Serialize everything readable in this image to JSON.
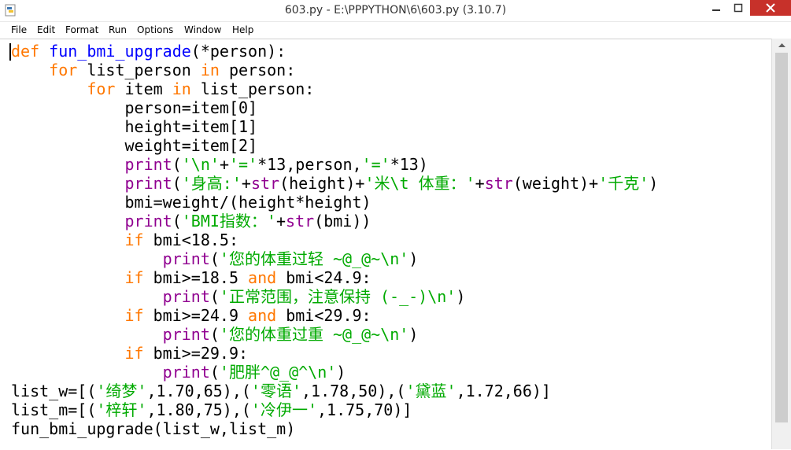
{
  "window": {
    "title": "603.py - E:\\PPPYTHON\\6\\603.py (3.10.7)"
  },
  "menu": [
    "File",
    "Edit",
    "Format",
    "Run",
    "Options",
    "Window",
    "Help"
  ],
  "code": {
    "l1": {
      "a": "def",
      "b": " ",
      "c": "fun_bmi_upgrade",
      "d": "(*person):"
    },
    "l2": {
      "a": "    ",
      "b": "for",
      "c": " list_person ",
      "d": "in",
      "e": " person:"
    },
    "l3": {
      "a": "        ",
      "b": "for",
      "c": " item ",
      "d": "in",
      "e": " list_person:"
    },
    "l4": "            person=item[0]",
    "l5": "            height=item[1]",
    "l6": "            weight=item[2]",
    "l7": {
      "a": "            ",
      "b": "print",
      "c": "(",
      "d": "'\\n'",
      "e": "+",
      "f": "'='",
      "g": "*13,person,",
      "h": "'='",
      "i": "*13)"
    },
    "l8": {
      "a": "            ",
      "b": "print",
      "c": "(",
      "d": "'身高:'",
      "e": "+",
      "f": "str",
      "g": "(height)+",
      "h": "'米\\t 体重：'",
      "i": "+",
      "j": "str",
      "k": "(weight)+",
      "l": "'千克'",
      "m": ")"
    },
    "l9": "            bmi=weight/(height*height)",
    "l10": {
      "a": "            ",
      "b": "print",
      "c": "(",
      "d": "'BMI指数：'",
      "e": "+",
      "f": "str",
      "g": "(bmi))"
    },
    "l11": {
      "a": "            ",
      "b": "if",
      "c": " bmi<18.5:"
    },
    "l12": {
      "a": "                ",
      "b": "print",
      "c": "(",
      "d": "'您的体重过轻 ~@_@~\\n'",
      "e": ")"
    },
    "l13": {
      "a": "            ",
      "b": "if",
      "c": " bmi>=18.5 ",
      "d": "and",
      "e": " bmi<24.9:"
    },
    "l14": {
      "a": "                ",
      "b": "print",
      "c": "(",
      "d": "'正常范围，注意保持 (-_-)\\n'",
      "e": ")"
    },
    "l15": {
      "a": "            ",
      "b": "if",
      "c": " bmi>=24.9 ",
      "d": "and",
      "e": " bmi<29.9:"
    },
    "l16": {
      "a": "                ",
      "b": "print",
      "c": "(",
      "d": "'您的体重过重 ~@_@~\\n'",
      "e": ")"
    },
    "l17": {
      "a": "            ",
      "b": "if",
      "c": " bmi>=29.9:"
    },
    "l18": {
      "a": "                ",
      "b": "print",
      "c": "(",
      "d": "'肥胖^@_@^\\n'",
      "e": ")"
    },
    "l19": {
      "a": "list_w=[(",
      "b": "'绮梦'",
      "c": ",1.70,65),(",
      "d": "'零语'",
      "e": ",1.78,50),(",
      "f": "'黛蓝'",
      "g": ",1.72,66)]"
    },
    "l20": {
      "a": "list_m=[(",
      "b": "'梓轩'",
      "c": ",1.80,75),(",
      "d": "'冷伊一'",
      "e": ",1.75,70)]"
    },
    "l21": "fun_bmi_upgrade(list_w,list_m)"
  },
  "colors": {
    "keyword": "#ff7700",
    "definition": "#0000ff",
    "builtin": "#900090",
    "string": "#00aa00",
    "close_button": "#c7312a"
  }
}
